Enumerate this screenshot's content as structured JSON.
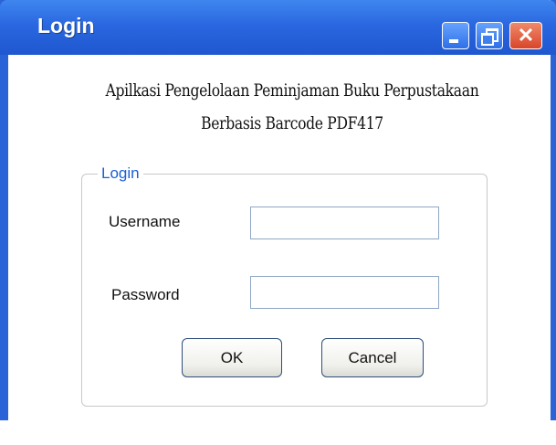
{
  "window": {
    "title": "Login",
    "controls": {
      "minimize": "minimize-icon",
      "maximize": "restore-icon",
      "close": "close-icon"
    }
  },
  "app": {
    "title_line1": "Apilkasi Pengelolaan Peminjaman Buku Perpustakaan",
    "title_line2": "Berbasis Barcode PDF417"
  },
  "login_group": {
    "legend": "Login",
    "username_label": "Username",
    "username_value": "",
    "password_label": "Password",
    "password_value": "",
    "ok_label": "OK",
    "cancel_label": "Cancel"
  },
  "colors": {
    "titlebar": "#2a67e0",
    "legend_text": "#1a5fd6",
    "close_button": "#d8452a"
  }
}
